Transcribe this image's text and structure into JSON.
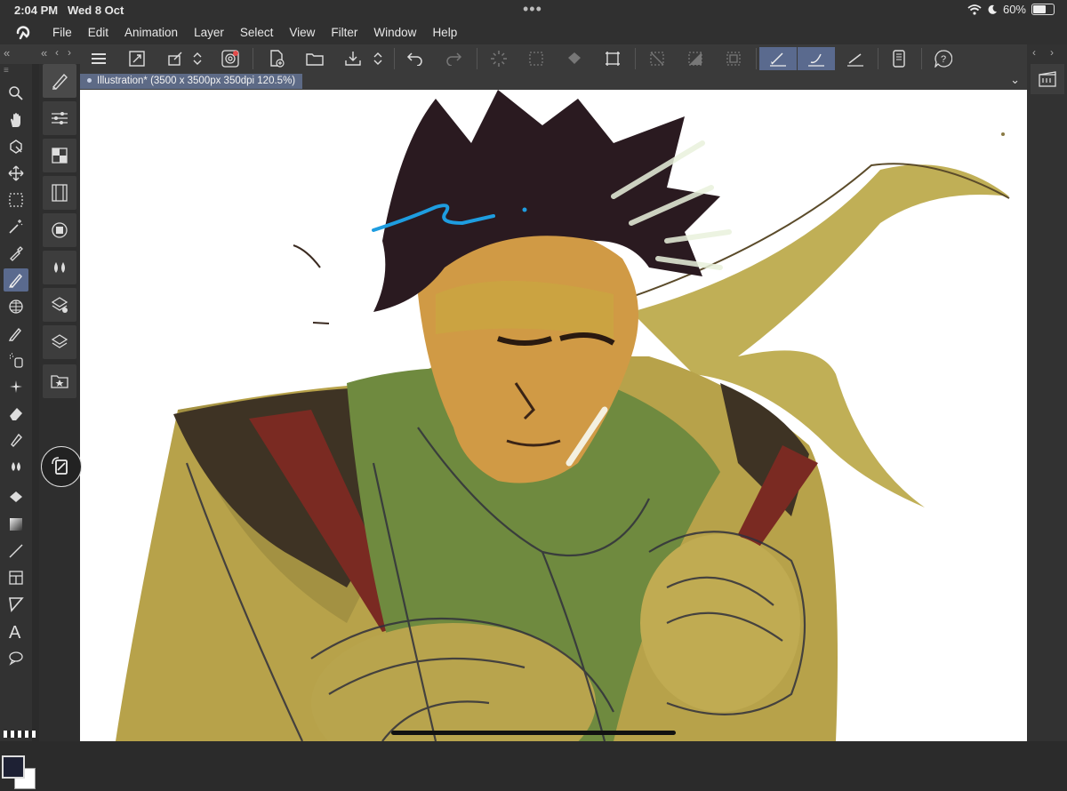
{
  "status": {
    "time": "2:04 PM",
    "date": "Wed 8 Oct",
    "battery": "60%",
    "battery_level": 0.6
  },
  "menu": [
    "File",
    "Edit",
    "Animation",
    "Layer",
    "Select",
    "View",
    "Filter",
    "Window",
    "Help"
  ],
  "document": {
    "tab_label": "Illustration* (3500 x 3500px 350dpi 120.5%)"
  },
  "toolbar_icons": [
    "menu-icon",
    "fit-icon",
    "transform-icon",
    "updown-icon",
    "spiral-icon",
    "new-icon",
    "open-icon",
    "save-icon",
    "updown2-icon",
    "undo-icon",
    "redo-icon",
    "loading-icon",
    "select-icon",
    "fill-icon",
    "crop-icon",
    "deselect-icon",
    "invert-icon",
    "border-icon",
    "pen-pressure-icon",
    "brush-icon",
    "ruler-icon",
    "phone-icon",
    "help-icon"
  ],
  "colors": {
    "main": "#1e2134",
    "sub": "#ffffff",
    "accent": "#5a6a8e"
  }
}
